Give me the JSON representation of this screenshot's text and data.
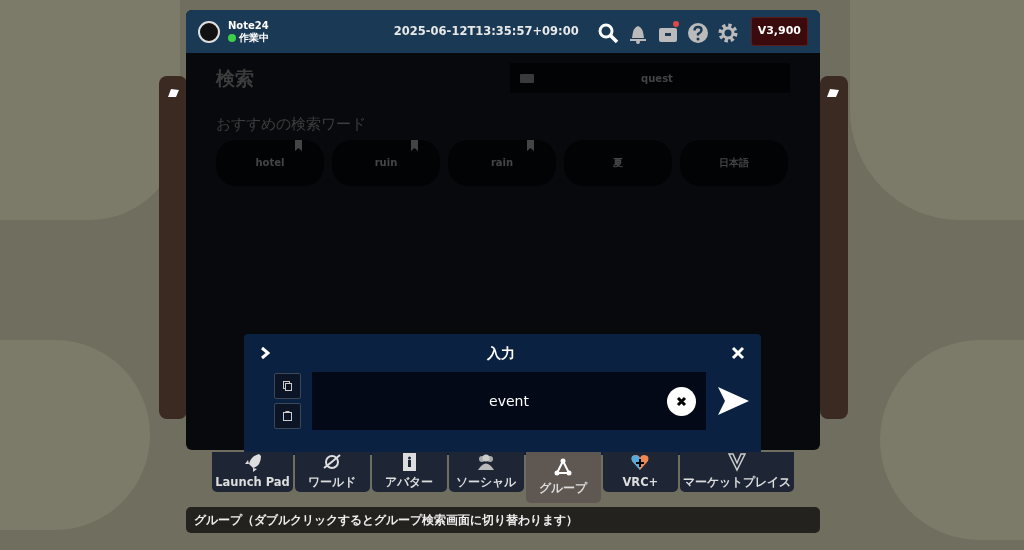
{
  "header": {
    "user_name": "Note24",
    "status": "作業中",
    "datetime": "2025-06-12T13:35:57+09:00",
    "icons": [
      {
        "kind": "search",
        "notification": false
      },
      {
        "kind": "bell",
        "notification": false
      },
      {
        "kind": "box",
        "notification": true
      },
      {
        "kind": "help",
        "notification": false
      },
      {
        "kind": "settings",
        "notification": false
      }
    ],
    "balance": "V3,900"
  },
  "search_page": {
    "title": "検索",
    "query": "quest",
    "recommended_title": "おすすめの検索ワード",
    "chips": [
      {
        "label": "hotel",
        "bookmarked": true
      },
      {
        "label": "ruin",
        "bookmarked": true
      },
      {
        "label": "rain",
        "bookmarked": true
      },
      {
        "label": "夏",
        "bookmarked": false
      },
      {
        "label": "日本語",
        "bookmarked": false
      }
    ]
  },
  "input_dialog": {
    "title": "入力",
    "value": "event"
  },
  "tabs": [
    {
      "label": "Launch Pad",
      "selected": false
    },
    {
      "label": "ワールド",
      "selected": false
    },
    {
      "label": "アバター",
      "selected": false
    },
    {
      "label": "ソーシャル",
      "selected": false
    },
    {
      "label": "グループ",
      "selected": true
    },
    {
      "label": "VRC+",
      "selected": false
    },
    {
      "label": "マーケットプレイス",
      "selected": false
    }
  ],
  "tooltip": "グループ（ダブルクリックするとグループ検索画面に切り替わります）"
}
